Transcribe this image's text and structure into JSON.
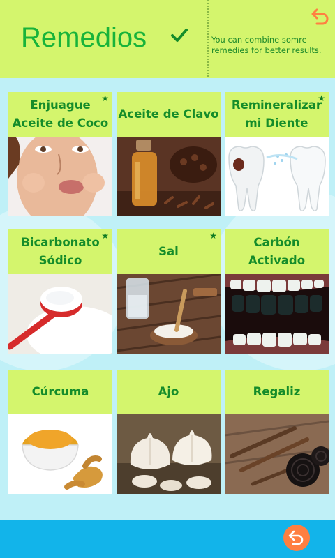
{
  "header": {
    "title": "Remedios",
    "note": "You can combine somre remedies for better results."
  },
  "remedies": [
    {
      "label": "Enjuague Aceite de Coco",
      "starred": true
    },
    {
      "label": "Aceite de Clavo",
      "starred": false
    },
    {
      "label": "Remineralizar mi Diente",
      "starred": true
    },
    {
      "label": "Bicarbonato Sódico",
      "starred": true
    },
    {
      "label": "Sal",
      "starred": true
    },
    {
      "label": "Carbón Activado",
      "starred": false
    },
    {
      "label": "Cúrcuma",
      "starred": false
    },
    {
      "label": "Ajo",
      "starred": false
    },
    {
      "label": "Regaliz",
      "starred": false
    }
  ],
  "icons": {
    "check": "check-icon",
    "undo": "undo-arrow-icon",
    "star": "star-icon"
  },
  "colors": {
    "header_bg": "#d4f56d",
    "title": "#18b33a",
    "footer_bg": "#12b4ea",
    "undo_button": "#ff7f41",
    "content_bg": "#bff0f7"
  }
}
